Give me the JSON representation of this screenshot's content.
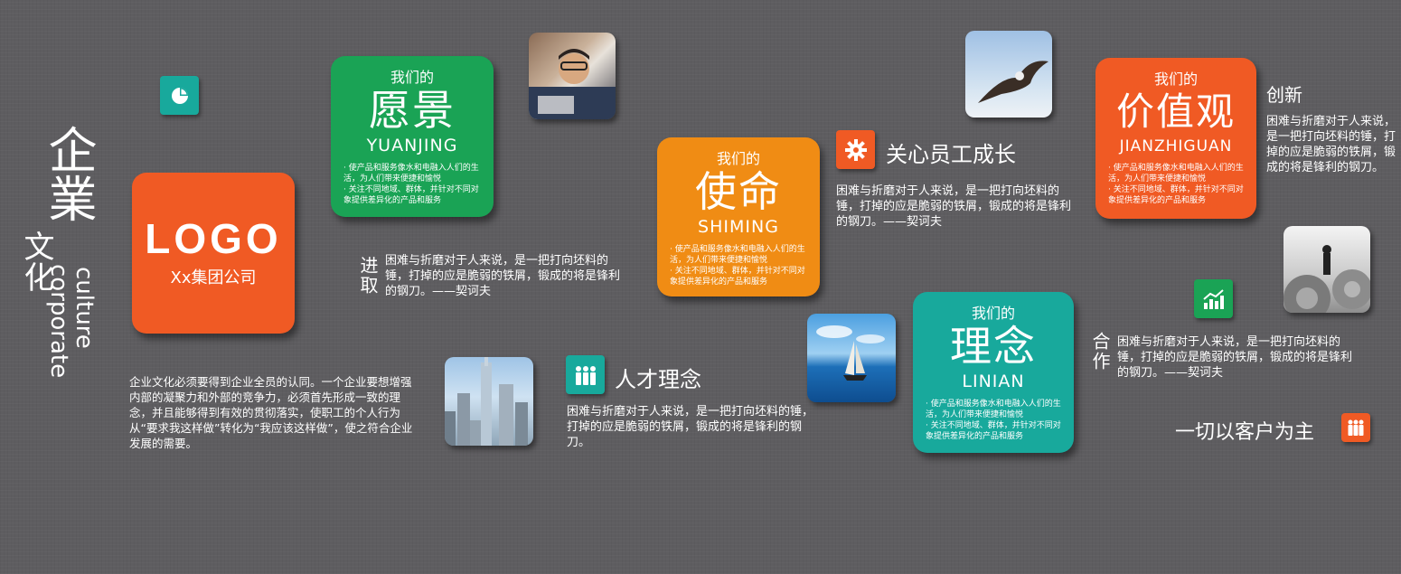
{
  "side_title": {
    "cn_top": "企業",
    "cn_bottom": "文化",
    "en_1": "culture",
    "en_2": "corporate"
  },
  "logo_card": {
    "logo_text": "LOGO",
    "company": "Xx集团公司",
    "color": "#f05a24"
  },
  "intro_text": "企业文化必须要得到企业全员的认同。一个企业要想增强内部的凝聚力和外部的竞争力，必须首先形成一致的理念，并且能够得到有效的贯彻落实，使职工的个人行为从“要求我这样做”转化为“我应该这样做”，使之符合企业发展的需要。",
  "cards": {
    "yuanjing": {
      "sub": "我们的",
      "big": "愿景",
      "pinyin": "YUANJING",
      "color": "#1aa355",
      "desc": "· 使产品和服务像水和电融入人们的生活，为人们带来便捷和愉悦\n· 关注不同地域、群体，并针对不同对象提供差异化的产品和服务"
    },
    "shiming": {
      "sub": "我们的",
      "big": "使命",
      "pinyin": "SHIMING",
      "color": "#f08c14",
      "desc": "· 使产品和服务像水和电融入人们的生活，为人们带来便捷和愉悦\n· 关注不同地域、群体，并针对不同对象提供差异化的产品和服务"
    },
    "jiazhiguan": {
      "sub": "我们的",
      "big": "价值观",
      "pinyin": "JIANZHIGUAN",
      "color": "#f05a24",
      "desc": "· 使产品和服务像水和电融入人们的生活，为人们带来便捷和愉悦\n· 关注不同地域、群体，并针对不同对象提供差异化的产品和服务"
    },
    "linian": {
      "sub": "我们的",
      "big": "理念",
      "pinyin": "LINIAN",
      "color": "#18a99c",
      "desc": "· 使产品和服务像水和电融入人们的生活，为人们带来便捷和愉悦\n· 关注不同地域、群体，并针对不同对象提供差异化的产品和服务"
    }
  },
  "jinqu": {
    "label": "进取",
    "text": "困难与折磨对于人来说，是一把打向坯料的锤，打掉的应是脆弱的铁屑，锻成的将是锋利的钢刀。——契诃夫"
  },
  "guanxin": {
    "heading": "关心员工成长",
    "text": "困难与折磨对于人来说，是一把打向坯料的锤，打掉的应是脆弱的铁屑，锻成的将是锋利的钢刀。——契诃夫"
  },
  "rencai": {
    "heading": "人才理念",
    "text": "困难与折磨对于人来说，是一把打向坯料的锤，打掉的应是脆弱的铁屑，锻成的将是锋利的钢刀。"
  },
  "chuangxin": {
    "heading": "创新",
    "text": "困难与折磨对于人来说，是一把打向坯料的锤，打掉的应是脆弱的铁屑，锻成的将是锋利的钢刀。——契诃夫"
  },
  "hezuo": {
    "label": "合作",
    "text": "困难与折磨对于人来说，是一把打向坯料的锤，打掉的应是脆弱的铁屑，锻成的将是锋利的钢刀。——契诃夫"
  },
  "kehu": {
    "heading": "一切以客户为主"
  },
  "icons": {
    "pie": "pie-chart-icon",
    "gear": "gear-icon",
    "people": "people-icon",
    "growth": "growth-chart-icon",
    "team": "team-icon"
  },
  "colors": {
    "background": "#5e5d60",
    "teal": "#18a99c",
    "green": "#1aa355",
    "orange": "#f08c14",
    "red_orange": "#f05a24"
  }
}
